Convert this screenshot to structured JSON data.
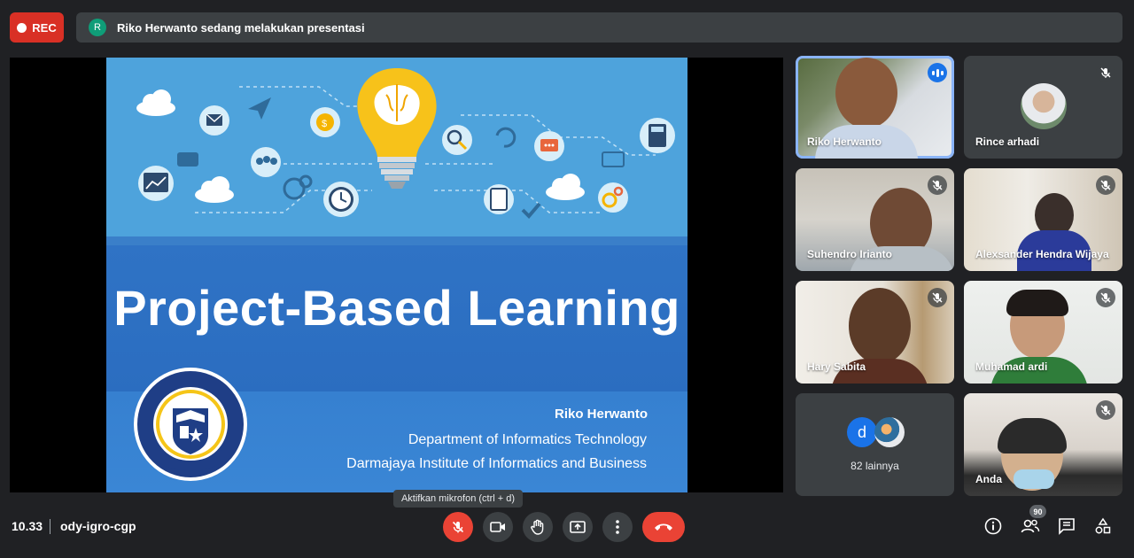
{
  "recording": {
    "label": "REC"
  },
  "presenting_bar": {
    "avatar_letter": "R",
    "text": "Riko Herwanto sedang melakukan presentasi"
  },
  "slide": {
    "title": "Project-Based Learning",
    "author": "Riko Herwanto",
    "line1": "Department of Informatics Technology",
    "line2": "Darmajaya Institute of Informatics and Business",
    "seal_text_top": "INSTITUT INFORMATIKA DAN BISNIS",
    "seal_motto": "EDUCATIO UNIVERSALIS",
    "seal_bottom": "DARMAJAYA"
  },
  "participants": [
    {
      "name": "Riko Herwanto",
      "status": "speaking"
    },
    {
      "name": "Rince arhadi",
      "status": "muted"
    },
    {
      "name": "Suhendro Irianto",
      "status": "muted"
    },
    {
      "name": "Alexsander Hendra Wijaya",
      "status": "muted"
    },
    {
      "name": "Hary Sabita",
      "status": "muted"
    },
    {
      "name": "Muhamad ardi",
      "status": "muted"
    },
    {
      "name": "Anda",
      "status": "muted"
    }
  ],
  "others": {
    "avatar_letter": "d",
    "label": "82 lainnya"
  },
  "tooltip": "Aktifkan mikrofon (ctrl + d)",
  "bottom_bar": {
    "time": "10.33",
    "meeting_code": "ody-igro-cgp",
    "people_count": "90"
  },
  "colors": {
    "accent": "#1a73e8",
    "danger": "#ea4335",
    "surface": "#3c4043",
    "background": "#202124"
  }
}
